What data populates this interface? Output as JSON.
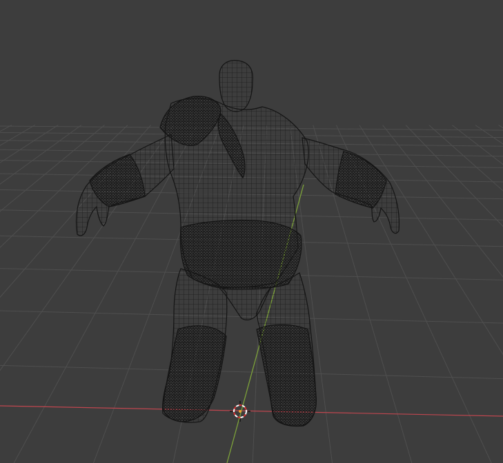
{
  "viewport": {
    "mode": "3d-viewport",
    "shading": "wireframe",
    "background_color": "#3d3d3d"
  },
  "grid": {
    "line_color": "#4f4f4f",
    "x_axis_color": "#c0464f",
    "y_axis_color": "#7da23a"
  },
  "mesh": {
    "object": "character-mesh",
    "wire_color": "#141414"
  },
  "cursor_3d": {
    "ring_colors": [
      "#ffffff",
      "#d82d2d"
    ]
  }
}
